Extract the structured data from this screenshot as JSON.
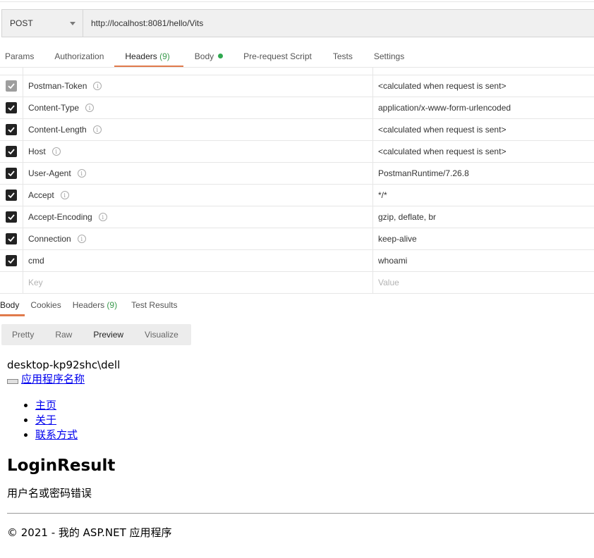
{
  "request": {
    "method": "POST",
    "url": "http://localhost:8081/hello/Vits"
  },
  "request_tabs": [
    {
      "label": "Params",
      "count": "",
      "active": false
    },
    {
      "label": "Authorization",
      "count": "",
      "active": false
    },
    {
      "label": "Headers",
      "count": "(9)",
      "active": true
    },
    {
      "label": "Body",
      "count": "",
      "active": false,
      "has_dot": true
    },
    {
      "label": "Pre-request Script",
      "count": "",
      "active": false
    },
    {
      "label": "Tests",
      "count": "",
      "active": false
    },
    {
      "label": "Settings",
      "count": "",
      "active": false
    }
  ],
  "headers": [
    {
      "key": "Postman-Token",
      "value": "<calculated when request is sent>",
      "checked": true,
      "disabled": true,
      "info": true
    },
    {
      "key": "Content-Type",
      "value": "application/x-www-form-urlencoded",
      "checked": true,
      "disabled": false,
      "info": true
    },
    {
      "key": "Content-Length",
      "value": "<calculated when request is sent>",
      "checked": true,
      "disabled": false,
      "info": true
    },
    {
      "key": "Host",
      "value": "<calculated when request is sent>",
      "checked": true,
      "disabled": false,
      "info": true
    },
    {
      "key": "User-Agent",
      "value": "PostmanRuntime/7.26.8",
      "checked": true,
      "disabled": false,
      "info": true
    },
    {
      "key": "Accept",
      "value": "*/*",
      "checked": true,
      "disabled": false,
      "info": true
    },
    {
      "key": "Accept-Encoding",
      "value": "gzip, deflate, br",
      "checked": true,
      "disabled": false,
      "info": true
    },
    {
      "key": "Connection",
      "value": "keep-alive",
      "checked": true,
      "disabled": false,
      "info": true
    },
    {
      "key": "cmd",
      "value": "whoami",
      "checked": true,
      "disabled": false,
      "info": false
    }
  ],
  "new_header": {
    "key_placeholder": "Key",
    "value_placeholder": "Value"
  },
  "response_tabs": [
    {
      "label": "Body",
      "count": "",
      "active": true
    },
    {
      "label": "Cookies",
      "count": "",
      "active": false
    },
    {
      "label": "Headers",
      "count": "(9)",
      "active": false
    },
    {
      "label": "Test Results",
      "count": "",
      "active": false
    }
  ],
  "view_modes": [
    {
      "label": "Pretty",
      "active": false
    },
    {
      "label": "Raw",
      "active": false
    },
    {
      "label": "Preview",
      "active": true
    },
    {
      "label": "Visualize",
      "active": false
    }
  ],
  "preview": {
    "user": "desktop-kp92shc\\dell",
    "brand": "应用程序名称",
    "nav": [
      "主页",
      "关于",
      "联系方式"
    ],
    "heading": "LoginResult",
    "message": "用户名或密码错误",
    "footer": "© 2021 - 我的 ASP.NET 应用程序"
  },
  "colors": {
    "accent": "#e07a4b",
    "count_green": "#3a9a4d",
    "dot_green": "#2fa84f",
    "link": "#0000ee"
  }
}
